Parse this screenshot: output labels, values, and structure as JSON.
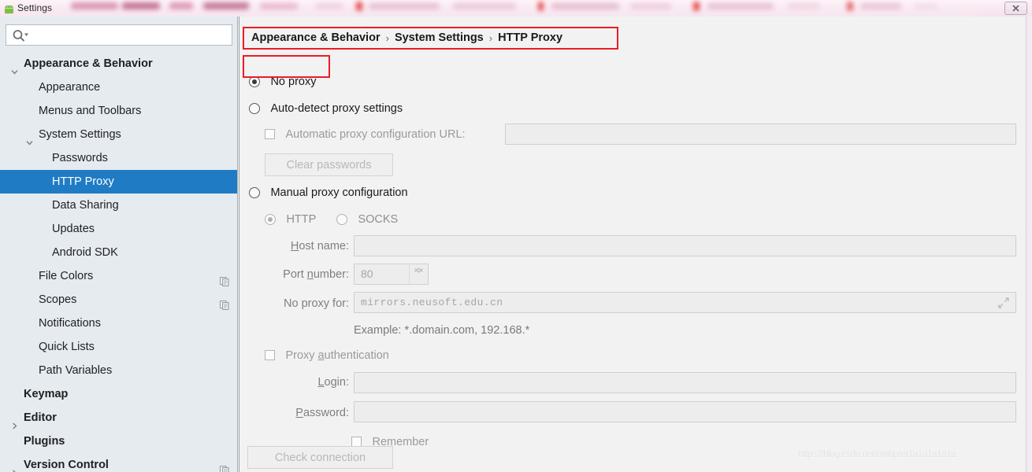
{
  "window": {
    "title": "Settings",
    "app_icon": "android-icon",
    "close_label": "✕"
  },
  "sidebar": {
    "search": {
      "placeholder": "",
      "value": "",
      "icon": "search-icon"
    },
    "items": [
      {
        "label": "Appearance & Behavior",
        "level": 0,
        "expanded": true,
        "bold": true,
        "selected": false,
        "copy_icon": false
      },
      {
        "label": "Appearance",
        "level": 1,
        "expanded": null,
        "bold": false,
        "selected": false,
        "copy_icon": false
      },
      {
        "label": "Menus and Toolbars",
        "level": 1,
        "expanded": null,
        "bold": false,
        "selected": false,
        "copy_icon": false
      },
      {
        "label": "System Settings",
        "level": 1,
        "expanded": true,
        "bold": false,
        "selected": false,
        "copy_icon": false
      },
      {
        "label": "Passwords",
        "level": 2,
        "expanded": null,
        "bold": false,
        "selected": false,
        "copy_icon": false
      },
      {
        "label": "HTTP Proxy",
        "level": 2,
        "expanded": null,
        "bold": false,
        "selected": true,
        "copy_icon": false
      },
      {
        "label": "Data Sharing",
        "level": 2,
        "expanded": null,
        "bold": false,
        "selected": false,
        "copy_icon": false
      },
      {
        "label": "Updates",
        "level": 2,
        "expanded": null,
        "bold": false,
        "selected": false,
        "copy_icon": false
      },
      {
        "label": "Android SDK",
        "level": 2,
        "expanded": null,
        "bold": false,
        "selected": false,
        "copy_icon": false
      },
      {
        "label": "File Colors",
        "level": 1,
        "expanded": null,
        "bold": false,
        "selected": false,
        "copy_icon": true
      },
      {
        "label": "Scopes",
        "level": 1,
        "expanded": null,
        "bold": false,
        "selected": false,
        "copy_icon": true
      },
      {
        "label": "Notifications",
        "level": 1,
        "expanded": null,
        "bold": false,
        "selected": false,
        "copy_icon": false
      },
      {
        "label": "Quick Lists",
        "level": 1,
        "expanded": null,
        "bold": false,
        "selected": false,
        "copy_icon": false
      },
      {
        "label": "Path Variables",
        "level": 1,
        "expanded": null,
        "bold": false,
        "selected": false,
        "copy_icon": false
      },
      {
        "label": "Keymap",
        "level": 0,
        "expanded": null,
        "bold": true,
        "selected": false,
        "copy_icon": false
      },
      {
        "label": "Editor",
        "level": 0,
        "expanded": false,
        "bold": true,
        "selected": false,
        "copy_icon": false
      },
      {
        "label": "Plugins",
        "level": 0,
        "expanded": null,
        "bold": true,
        "selected": false,
        "copy_icon": false
      },
      {
        "label": "Version Control",
        "level": 0,
        "expanded": false,
        "bold": true,
        "selected": false,
        "copy_icon": true
      }
    ]
  },
  "main": {
    "breadcrumb": {
      "part1": "Appearance & Behavior",
      "sep1": "›",
      "part2": "System Settings",
      "sep2": "›",
      "part3": "HTTP Proxy"
    },
    "no_proxy_label": "No proxy",
    "auto_detect_label": "Auto-detect proxy settings",
    "auto_config_url_label": "Automatic proxy configuration URL:",
    "auto_config_url_value": "",
    "clear_passwords_label": "Clear passwords",
    "manual_label": "Manual proxy configuration",
    "http_label": "HTTP",
    "socks_label": "SOCKS",
    "host_name_label": "Host name:",
    "host_name_value": "",
    "port_number_label": "Port number:",
    "port_number_value": "80",
    "no_proxy_for_label": "No proxy for:",
    "no_proxy_for_value": "mirrors.neusoft.edu.cn",
    "example_text": "Example: *.domain.com, 192.168.*",
    "proxy_auth_label": "Proxy authentication",
    "login_label": "Login:",
    "login_value": "",
    "password_label": "Password:",
    "password_value": "",
    "remember_label": "Remember",
    "check_connection_label": "Check connection",
    "watermark": "https://blog.csdn.net/embpret1a1a1a1a1a"
  },
  "colors": {
    "selection_blue": "#1f7cc4",
    "highlight_red": "#ec1c24",
    "sidebar_bg": "#e6ebf0",
    "panel_bg": "#f2f2f2",
    "field_bg": "#ededed"
  }
}
